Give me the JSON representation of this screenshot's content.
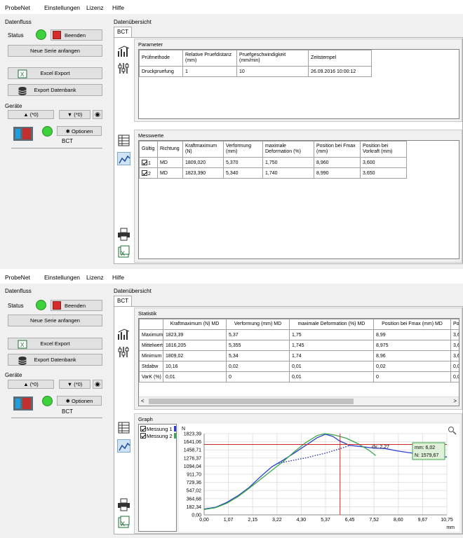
{
  "menu": [
    "ProbeNet",
    "Einstellungen",
    "Lizenz",
    "Hilfe"
  ],
  "left": {
    "datenfluss": "Datenfluss",
    "status_label": "Status",
    "beenden": "Beenden",
    "neue_serie": "Neue Serie anfangen",
    "excel_export": "Excel Export",
    "export_db": "Export Datenbank",
    "geraete": "Geräte",
    "up_count": "(*0)",
    "down_count": "(*0)",
    "optionen": "Optionen",
    "device_name": "BCT"
  },
  "main": {
    "title": "Datenübersicht",
    "tab": "BCT"
  },
  "screen1": {
    "parameter_title": "Parameter",
    "param_headers": [
      "Prüfmethode",
      "Relative Pruefdistanz (mm)",
      "Pruefgeschwindigkeit (mm/min)",
      "Zeitstempel"
    ],
    "param_row": [
      "Druckpruefung",
      "1",
      "10",
      "26.09.2016 10:00:12"
    ],
    "messwerte_title": "Messwerte",
    "mess_headers": [
      "Gültig",
      "Richtung",
      "Kraftmaximum (N)",
      "Verformung (mm)",
      "maximale Deformation (%)",
      "Position bei Fmax (mm)",
      "Position bei Vorkraft (mm)"
    ],
    "mess_rows": [
      {
        "n": "1",
        "richtung": "MD",
        "vals": [
          "1809,020",
          "5,370",
          "1,750",
          "8,960",
          "3,600"
        ]
      },
      {
        "n": "2",
        "richtung": "MD",
        "vals": [
          "1823,390",
          "5,340",
          "1,740",
          "8,990",
          "3,650"
        ]
      }
    ]
  },
  "screen2": {
    "statistik_title": "Statistik",
    "stat_headers": [
      "",
      "Kraftmaximum (N) MD",
      "Verformung (mm) MD",
      "maximale Deformation (%) MD",
      "Position bei Fmax (mm) MD",
      "Po"
    ],
    "stat_rows": [
      [
        "Maximum",
        "1823,39",
        "5,37",
        "1,75",
        "8,99",
        "3,65"
      ],
      [
        "Mittelwert",
        "1816,205",
        "5,355",
        "1,745",
        "8,975",
        "3,62"
      ],
      [
        "Minimum",
        "1809,02",
        "5,34",
        "1,74",
        "8,96",
        "3,6"
      ],
      [
        "Stdabw",
        "10,16",
        "0,02",
        "0,01",
        "0,02",
        "0,04"
      ],
      [
        "VarK (%)",
        "0,01",
        "0",
        "0,01",
        "0",
        "0,01"
      ]
    ],
    "graph_title": "Graph",
    "legend": [
      {
        "label": "Messung 1",
        "color": "#2d3fd0"
      },
      {
        "label": "Messung 2",
        "color": "#3aa84a"
      }
    ],
    "y_unit": "N",
    "x_unit": "mm",
    "cursor_dx": "dx: 2,27",
    "cursor_mm": "mm: 6,02",
    "cursor_n": "N: 1579,67"
  },
  "chart_data": {
    "type": "line",
    "xlabel": "mm",
    "ylabel": "N",
    "xlim": [
      0,
      10.75
    ],
    "ylim": [
      0,
      1823.39
    ],
    "x_ticks": [
      "0,00",
      "1,07",
      "2,15",
      "3,22",
      "4,30",
      "5,37",
      "6,45",
      "7,52",
      "8,60",
      "9,67",
      "10,75"
    ],
    "y_ticks": [
      "0,00",
      "182,34",
      "364,68",
      "547,02",
      "729,36",
      "911,70",
      "1094,04",
      "1276,37",
      "1458,71",
      "1641,06",
      "1823,39"
    ],
    "series": [
      {
        "name": "Messung 1",
        "color": "#2d3fd0",
        "x": [
          0,
          0.5,
          1.0,
          1.5,
          2.0,
          2.5,
          3.0,
          3.5,
          4.0,
          4.5,
          5.0,
          5.37,
          5.7,
          6.0,
          6.45,
          7.0,
          7.5,
          8.0,
          8.5,
          9.0,
          9.5,
          10.0,
          10.75
        ],
        "y": [
          130,
          170,
          280,
          430,
          620,
          860,
          1080,
          1230,
          1390,
          1560,
          1730,
          1809,
          1760,
          1660,
          1560,
          1530,
          1500,
          1490,
          1440,
          1400,
          1370,
          1330,
          1300
        ]
      },
      {
        "name": "Messung 2",
        "color": "#3aa84a",
        "x": [
          0,
          0.5,
          1.0,
          1.5,
          2.0,
          2.5,
          3.0,
          3.5,
          4.0,
          4.5,
          5.0,
          5.34,
          5.8,
          6.3,
          6.8,
          7.3,
          7.6
        ],
        "y": [
          120,
          160,
          260,
          410,
          600,
          800,
          1000,
          1200,
          1420,
          1620,
          1780,
          1823,
          1790,
          1720,
          1600,
          1450,
          1330
        ]
      },
      {
        "name": "",
        "color": "#1c2aa0",
        "style": "dotted",
        "x": [
          3.3,
          4.5,
          5.4,
          6.0,
          6.45
        ],
        "y": [
          1160,
          1280,
          1390,
          1480,
          1560
        ]
      }
    ],
    "crosshair": {
      "x": 6.02,
      "y": 1579.67
    }
  }
}
